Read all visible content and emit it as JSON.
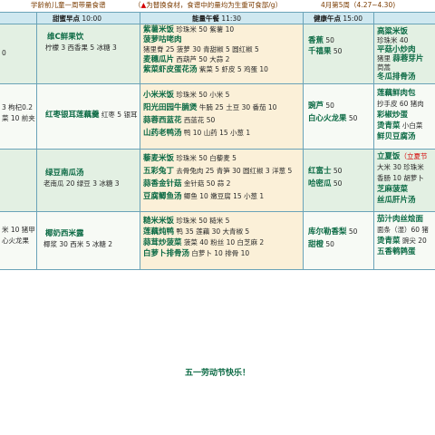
{
  "title": {
    "prefix": "学龄前儿童一周带量食谱",
    "note_triangle": "▲",
    "note_text": "为替换食材，食谱中的量均为生重可食部/g）",
    "note_open": "（",
    "week": "4月第5周（4.27~4.30)"
  },
  "headers": {
    "snack_am": "甜蜜早点",
    "snack_am_time": "10:00",
    "lunch": "能量午餐",
    "lunch_time": "11:30",
    "snack_pm": "健康午点",
    "snack_pm_time": "15:00"
  },
  "rows": [
    {
      "left": [
        "",
        "0"
      ],
      "am": {
        "dish": "维C鲜果饮",
        "ing": "柠檬 3  西香果 5  冰糖 3"
      },
      "lunch": [
        {
          "dish": "紫薯米饭",
          "ing": "珍珠米 50  紫薯 10"
        },
        {
          "dish": "菠萝咕咾肉",
          "ing": ""
        },
        {
          "dish": "",
          "ing": "猪里脊 25  菠萝 30  青甜椒 5  圆红椒 5"
        },
        {
          "dish": "麦穗瓜片",
          "ing": "西葫芦 50  大蒜 2"
        },
        {
          "dish": "紫菜虾皮蛋花汤",
          "ing": "紫菜 5  虾皮 5  鸡蛋 10"
        }
      ],
      "pm": [
        {
          "dish": "香蕉",
          "ing": "50"
        },
        {
          "dish": "千禧果",
          "ing": "50"
        }
      ],
      "right": [
        {
          "dish": "高粱米饭",
          "ing": "珍珠米 40"
        },
        {
          "dish": "平菇小炒肉",
          "ing": "猪里"
        },
        {
          "dish": "蒜蓉芽片",
          "ing": "茼蒿"
        },
        {
          "dish": "冬瓜排骨汤",
          "ing": ""
        }
      ]
    },
    {
      "left": [
        "3  枸杞0.2",
        "菜 10  前夹"
      ],
      "am": {
        "dish": "红枣银耳莲藕羹",
        "ing": "红枣 5  银耳 10  莲藕 20  10"
      },
      "lunch": [
        {
          "dish": "小米米饭",
          "ing": "珍珠米 50  小米 5"
        },
        {
          "dish": "阳光田园牛腩煲",
          "ing": "牛腩 25  土豆 30  番茄 10"
        },
        {
          "dish": "蒜蓉西蓝花",
          "ing": "西蓝花 50"
        },
        {
          "dish": "山药老鸭汤",
          "ing": "鸭 10  山药 15  小葱 1"
        }
      ],
      "pm": [
        {
          "dish": "豌芦",
          "ing": "50"
        },
        {
          "dish": "白心火龙果",
          "ing": "50"
        }
      ],
      "right": [
        {
          "dish": "莲藕鲜肉包",
          "ing": ""
        },
        {
          "dish": "",
          "ing": "抄手皮 60  猪肉"
        },
        {
          "dish": "彩椒炒蛋",
          "ing": ""
        },
        {
          "dish": "烫青菜",
          "ing": "小白菜"
        },
        {
          "dish": "鲜贝豆腐汤",
          "ing": ""
        }
      ]
    },
    {
      "left": [
        "",
        ""
      ],
      "am": {
        "dish": "绿豆南瓜汤",
        "ing": "老南瓜 20  绿豆 3  冰糖 3"
      },
      "lunch": [
        {
          "dish": "藜麦米饭",
          "ing": "珍珠米 50  白藜麦 5"
        },
        {
          "dish": "五彩兔丁",
          "ing": "去骨兔肉 25  青笋 30  圆红椒 3  洋葱 5"
        },
        {
          "dish": "蒜香金针菇",
          "ing": "金针菇 50  蒜 2"
        },
        {
          "dish": "豆腐鲫鱼汤",
          "ing": "鲫鱼 10  嫩豆腐 15  小葱 1"
        }
      ],
      "pm": [
        {
          "dish": "红富士",
          "ing": "50"
        },
        {
          "dish": "哈密瓜",
          "ing": "50"
        }
      ],
      "right": [
        {
          "dish": "立夏饭",
          "ing": "（立夏节"
        },
        {
          "dish": "",
          "ing": "大米 30  珍珠米"
        },
        {
          "dish": "",
          "ing": "香肠 10  胡萝卜"
        },
        {
          "dish": "芝麻菠菜",
          "ing": ""
        },
        {
          "dish": "丝瓜肝片汤",
          "ing": ""
        }
      ]
    },
    {
      "left": [
        "米 10  猪甲",
        "心火龙果"
      ],
      "am": {
        "dish": "椰奶西米露",
        "ing": "椰浆 30  西米 5  冰糖 2"
      },
      "lunch": [
        {
          "dish": "糙米米饭",
          "ing": "珍珠米 50  糙米 5"
        },
        {
          "dish": "莲藕炖鸭",
          "ing": "鸭 35  莲藕 30  大青椒 5"
        },
        {
          "dish": "蒜茸炒菠菜",
          "ing": "菠菜 40  粉丝 10  白芝麻 2"
        },
        {
          "dish": "白萝卜排骨汤",
          "ing": "白萝卜 10  排骨 10"
        }
      ],
      "pm": [
        {
          "dish": "库尔勒香梨",
          "ing": "50"
        },
        {
          "dish": "甜橙",
          "ing": "50"
        }
      ],
      "right": [
        {
          "dish": "茄汁肉丝烩面",
          "ing": ""
        },
        {
          "dish": "",
          "ing": "面条（湿）60  猪"
        },
        {
          "dish": "烫青菜",
          "ing": "豌尖 20"
        },
        {
          "dish": "五香鹌鹑蛋",
          "ing": ""
        }
      ]
    }
  ],
  "footer": "五一劳动节快乐！"
}
